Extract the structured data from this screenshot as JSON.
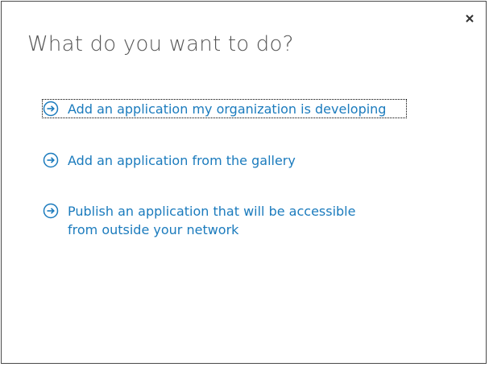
{
  "dialog": {
    "title": "What do you want to do?",
    "close_glyph": "×",
    "options": [
      {
        "label": "Add an application my organization is developing",
        "icon": "arrow-circle-right-icon",
        "focused": true
      },
      {
        "label": "Add an application from the gallery",
        "icon": "arrow-circle-right-icon",
        "focused": false
      },
      {
        "label": "Publish an application that will be accessible from outside your network",
        "icon": "arrow-circle-right-icon",
        "focused": false
      }
    ]
  },
  "colors": {
    "link": "#1b7bbd",
    "title": "#555555",
    "border": "#4a4a4a"
  }
}
